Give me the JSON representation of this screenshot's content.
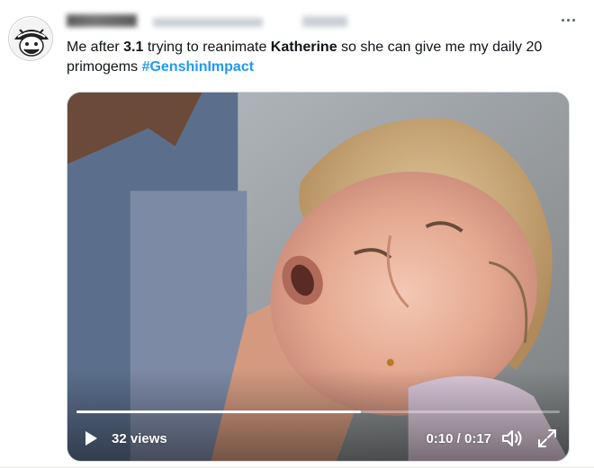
{
  "tweet": {
    "text": {
      "part1": "Me after ",
      "version": "3.1",
      "part2": " trying to reanimate ",
      "character": "Katherine",
      "part3": " so she can give me my daily 20 primogems ",
      "hashtag": "#GenshinImpact"
    },
    "colors": {
      "link": "#1d9bf0",
      "text": "#0f1419"
    }
  },
  "video": {
    "views": "32 views",
    "time": "0:10 / 0:17",
    "progress": 0.588
  }
}
